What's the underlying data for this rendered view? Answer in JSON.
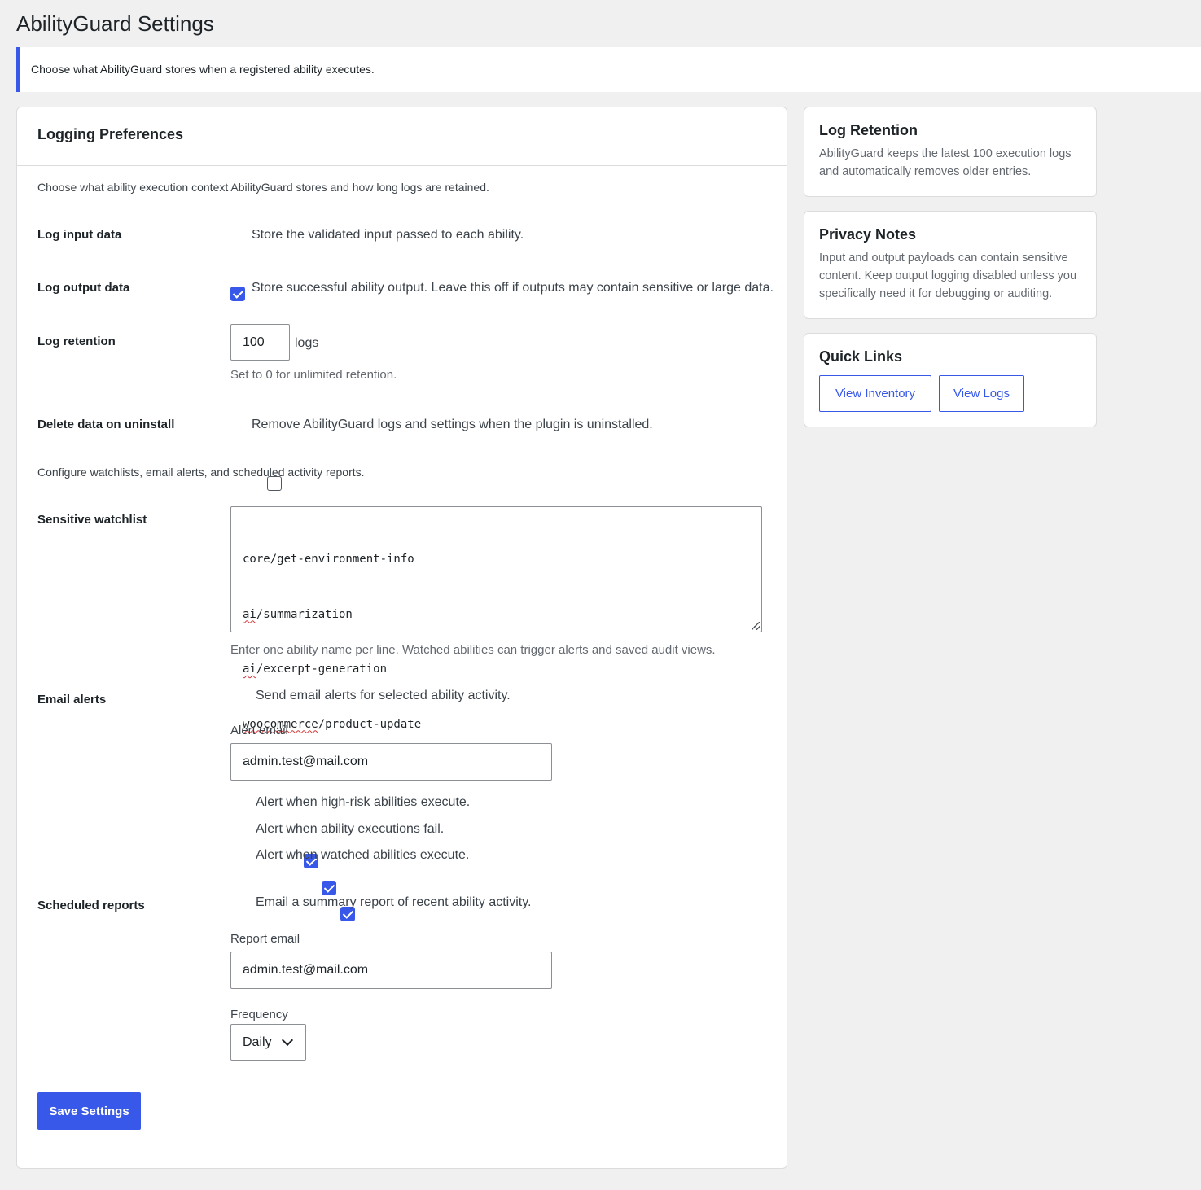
{
  "page": {
    "title": "AbilityGuard Settings",
    "notice": "Choose what AbilityGuard stores when a registered ability executes."
  },
  "main": {
    "card_title": "Logging Preferences",
    "intro": "Choose what ability execution context AbilityGuard stores and how long logs are retained.",
    "log_input": {
      "label": "Log input data",
      "option": "Store the validated input passed to each ability.",
      "checked": true
    },
    "log_output": {
      "label": "Log output data",
      "option": "Store successful ability output. Leave this off if outputs may contain sensitive or large data.",
      "checked": true
    },
    "retention": {
      "label": "Log retention",
      "value": "100",
      "unit": "logs",
      "help": "Set to 0 for unlimited retention."
    },
    "delete_uninstall": {
      "label": "Delete data on uninstall",
      "option": "Remove AbilityGuard logs and settings when the plugin is uninstalled.",
      "checked": false
    },
    "alerts_intro": "Configure watchlists, email alerts, and scheduled activity reports.",
    "watchlist": {
      "label": "Sensitive watchlist",
      "lines": [
        {
          "prefix": "core",
          "rest": "/get-environment-info"
        },
        {
          "prefix": "ai",
          "rest": "/summarization"
        },
        {
          "prefix": "ai",
          "rest": "/excerpt-generation"
        },
        {
          "prefix": "woocommerce",
          "rest": "/product-update"
        }
      ],
      "help": "Enter one ability name per line. Watched abilities can trigger alerts and saved audit views."
    },
    "email_alerts": {
      "label": "Email alerts",
      "option": "Send email alerts for selected ability activity.",
      "checked": true,
      "email_label": "Alert email",
      "email_value": "admin.test@mail.com",
      "sub_options": [
        {
          "label": "Alert when high-risk abilities execute.",
          "checked": true
        },
        {
          "label": "Alert when ability executions fail.",
          "checked": true
        },
        {
          "label": "Alert when watched abilities execute.",
          "checked": true
        }
      ]
    },
    "reports": {
      "label": "Scheduled reports",
      "option": "Email a summary report of recent ability activity.",
      "checked": true,
      "email_label": "Report email",
      "email_value": "admin.test@mail.com",
      "frequency_label": "Frequency",
      "frequency_value": "Daily"
    },
    "save_label": "Save Settings"
  },
  "sidebar": {
    "retention": {
      "title": "Log Retention",
      "text": "AbilityGuard keeps the latest 100 execution logs and automatically removes older entries."
    },
    "privacy": {
      "title": "Privacy Notes",
      "text": "Input and output payloads can contain sensitive content. Keep output logging disabled unless you specifically need it for debugging or auditing."
    },
    "quick_links": {
      "title": "Quick Links",
      "inventory_label": "View Inventory",
      "logs_label": "View Logs"
    }
  },
  "colors": {
    "accent": "#3858e9",
    "background": "#f0f0f1",
    "spellcheck": "#d63638"
  },
  "icons": {
    "checkbox_checked": "checkmark-icon",
    "select": "chevron-down-icon",
    "resize": "resize-handle-icon"
  }
}
